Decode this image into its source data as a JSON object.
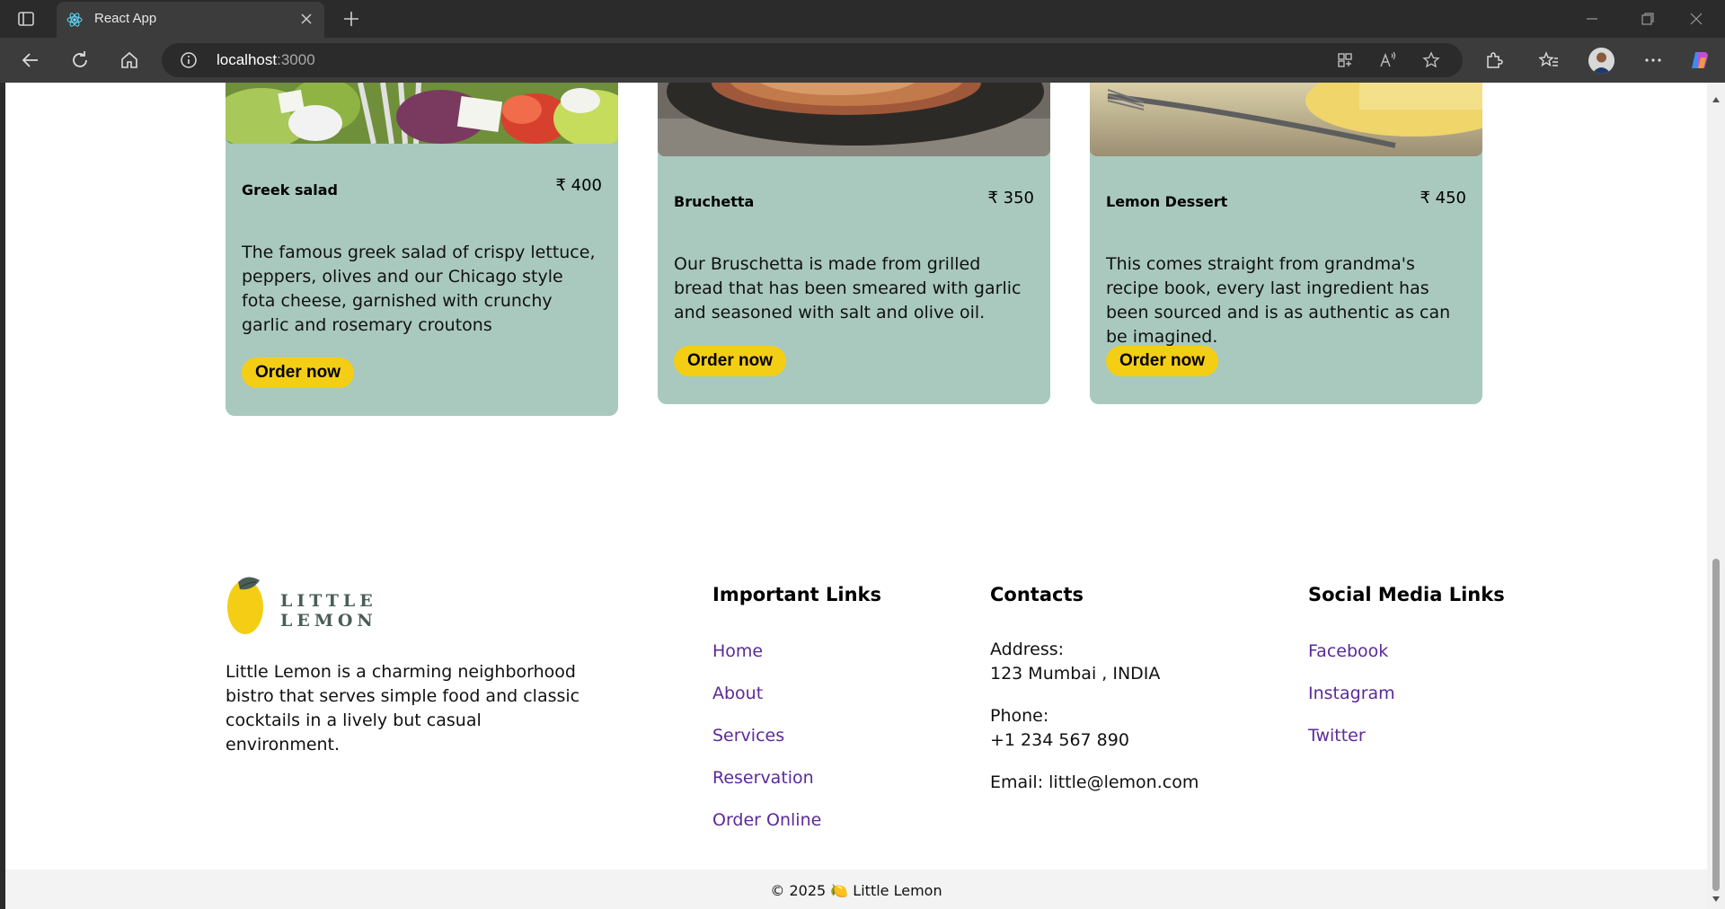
{
  "browser": {
    "tab_title": "React App",
    "address_host": "localhost",
    "address_port": ":3000"
  },
  "menu": [
    {
      "name": "Greek salad",
      "price": "₹ 400",
      "description": "The famous greek salad of crispy lettuce, peppers, olives and our Chicago style fota cheese, garnished with crunchy garlic and rosemary croutons",
      "button": "Order now"
    },
    {
      "name": "Bruchetta",
      "price": "₹ 350",
      "description": "Our Bruschetta is made from grilled bread that has been smeared with garlic and seasoned with salt and olive oil.",
      "button": "Order now"
    },
    {
      "name": "Lemon Dessert",
      "price": "₹ 450",
      "description": "This comes straight from grandma's recipe book, every last ingredient has been sourced and is as authentic as can be imagined.",
      "button": "Order now"
    }
  ],
  "footer": {
    "brand_name": "LITTLE LEMON",
    "description": "Little Lemon is a charming neighborhood bistro that serves simple food and classic cocktails in a lively but casual environment.",
    "important_links": {
      "heading": "Important Links",
      "items": [
        "Home",
        "About",
        "Services",
        "Reservation",
        "Order Online"
      ]
    },
    "contacts": {
      "heading": "Contacts",
      "address_label": "Address:",
      "address_value": "123 Mumbai , INDIA",
      "phone_label": "Phone:",
      "phone_value": "+1 234 567 890",
      "email": "Email: little@lemon.com"
    },
    "social": {
      "heading": "Social Media Links",
      "items": [
        "Facebook",
        "Instagram",
        "Twitter"
      ]
    },
    "copyright": "© 2025 🍋 Little Lemon"
  },
  "colors": {
    "card_bg": "#a9c9be",
    "button_yellow": "#f4ce14",
    "link_purple": "#5b2a9a",
    "brand_dark": "#495e57"
  }
}
